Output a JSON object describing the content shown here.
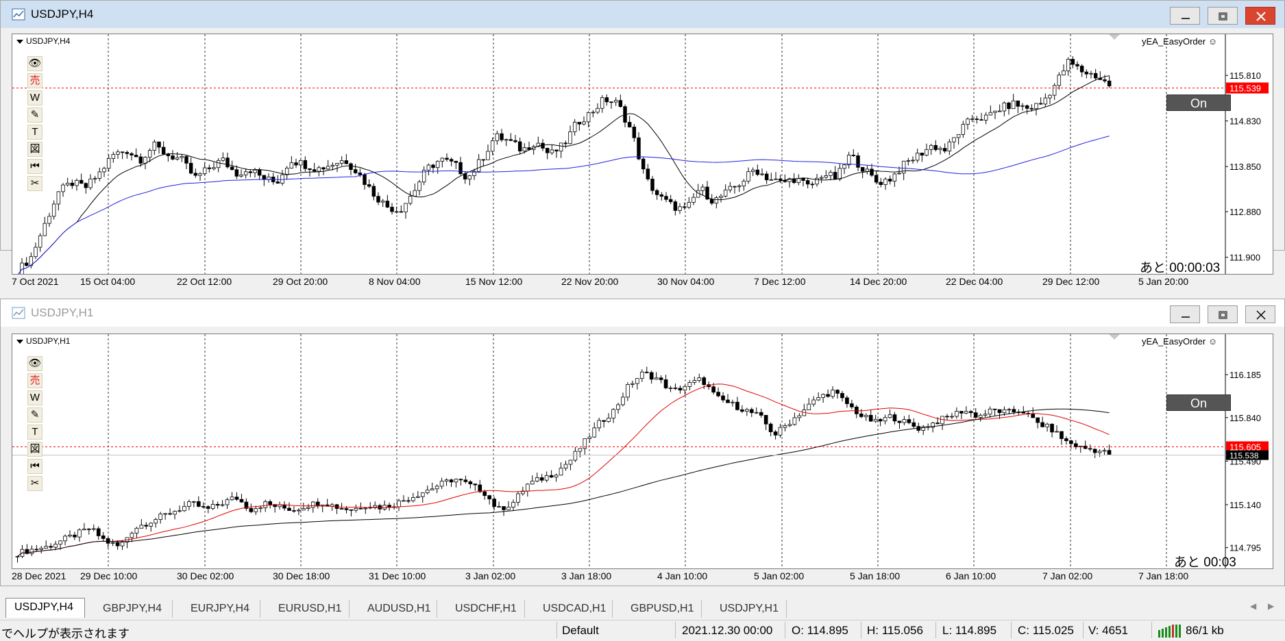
{
  "window1": {
    "title": "USDJPY,H4",
    "symbol_label": "USDJPY,H4",
    "ea_label": "yEA_EasyOrder ☺",
    "on_label": "On",
    "remaining": "あと 00:00:03",
    "current_price": "115.539",
    "price_axis": [
      "115.810",
      "114.830",
      "113.850",
      "112.880",
      "111.900"
    ],
    "x_labels": [
      "7 Oct 2021",
      "15 Oct 04:00",
      "22 Oct 12:00",
      "29 Oct 20:00",
      "8 Nov 04:00",
      "15 Nov 12:00",
      "22 Nov 20:00",
      "30 Nov 04:00",
      "7 Dec 12:00",
      "14 Dec 20:00",
      "22 Dec 04:00",
      "29 Dec 12:00",
      "5 Jan 20:00"
    ]
  },
  "window2": {
    "title": "USDJPY,H1",
    "symbol_label": "USDJPY,H1",
    "ea_label": "yEA_EasyOrder ☺",
    "on_label": "On",
    "remaining": "あと 00:03",
    "current_price": "115.605",
    "bid_price": "115.538",
    "price_axis": [
      "116.185",
      "115.840",
      "115.490",
      "115.140",
      "114.795"
    ],
    "x_labels": [
      "28 Dec 2021",
      "29 Dec 10:00",
      "30 Dec 02:00",
      "30 Dec 18:00",
      "31 Dec 10:00",
      "3 Jan 02:00",
      "3 Jan 18:00",
      "4 Jan 10:00",
      "5 Jan 02:00",
      "5 Jan 18:00",
      "6 Jan 10:00",
      "7 Jan 02:00",
      "7 Jan 18:00"
    ]
  },
  "tools": [
    {
      "name": "eye-icon",
      "glyph": "👁"
    },
    {
      "name": "sell-icon",
      "glyph": "売"
    },
    {
      "name": "w-icon",
      "glyph": "W"
    },
    {
      "name": "pencil-icon",
      "glyph": "✎"
    },
    {
      "name": "text-icon",
      "glyph": "T"
    },
    {
      "name": "figure-icon",
      "glyph": "図"
    },
    {
      "name": "rewind-icon",
      "glyph": "⏮"
    },
    {
      "name": "scissors-icon",
      "glyph": "✂"
    }
  ],
  "tabs": [
    "USDJPY,H4",
    "GBPJPY,H4",
    "EURJPY,H4",
    "EURUSD,H1",
    "AUDUSD,H1",
    "USDCHF,H1",
    "USDCAD,H1",
    "GBPUSD,H1",
    "USDJPY,H1"
  ],
  "status": {
    "help": "でヘルプが表示されます",
    "profile": "Default",
    "datetime": "2021.12.30 00:00",
    "open": "O: 114.895",
    "high": "H: 115.056",
    "low": "L: 114.895",
    "close": "C: 115.025",
    "volume": "V: 4651",
    "traffic": "86/1 kb"
  },
  "colors": {
    "ma_blue": "#2020e0",
    "ma_red": "#e00000",
    "price_red": "#ff0000",
    "bid_black": "#000000",
    "active_title": "#cfe0f2"
  },
  "chart_data": [
    {
      "type": "candlestick",
      "symbol": "USDJPY",
      "timeframe": "H4",
      "ylim": [
        111.6,
        116.4
      ],
      "x_ticks": [
        "7 Oct 2021",
        "15 Oct 04:00",
        "22 Oct 12:00",
        "29 Oct 20:00",
        "8 Nov 04:00",
        "15 Nov 12:00",
        "22 Nov 20:00",
        "30 Nov 04:00",
        "7 Dec 12:00",
        "14 Dec 20:00",
        "22 Dec 04:00",
        "29 Dec 12:00",
        "5 Jan 20:00"
      ],
      "y_ticks": [
        115.81,
        114.83,
        113.85,
        112.88,
        111.9
      ],
      "current_price": 115.539,
      "close_path": [
        111.6,
        111.9,
        112.6,
        113.3,
        113.5,
        113.4,
        113.7,
        114.1,
        114.2,
        114.0,
        114.3,
        114.1,
        114.0,
        113.6,
        113.8,
        114.0,
        113.7,
        113.8,
        113.6,
        113.5,
        114.0,
        113.9,
        113.8,
        113.9,
        114.0,
        113.7,
        113.3,
        113.0,
        112.9,
        113.3,
        113.8,
        114.0,
        113.9,
        113.6,
        114.0,
        114.5,
        114.4,
        114.2,
        114.4,
        114.1,
        114.3,
        114.8,
        115.0,
        115.3,
        115.2,
        114.6,
        113.6,
        113.2,
        113.0,
        112.9,
        113.4,
        113.1,
        113.3,
        113.5,
        113.8,
        113.6,
        113.5,
        113.6,
        113.4,
        113.7,
        113.6,
        114.1,
        113.8,
        113.5,
        113.6,
        113.9,
        114.1,
        114.3,
        114.2,
        114.6,
        114.9,
        114.9,
        115.1,
        115.2,
        115.1,
        115.2,
        115.6,
        116.1,
        115.9,
        115.8,
        115.6
      ]
    },
    {
      "type": "candlestick",
      "symbol": "USDJPY",
      "timeframe": "H1",
      "ylim": [
        114.65,
        116.4
      ],
      "x_ticks": [
        "28 Dec 2021",
        "29 Dec 10:00",
        "30 Dec 02:00",
        "30 Dec 18:00",
        "31 Dec 10:00",
        "3 Jan 02:00",
        "3 Jan 18:00",
        "4 Jan 10:00",
        "5 Jan 02:00",
        "5 Jan 18:00",
        "6 Jan 10:00",
        "7 Jan 02:00",
        "7 Jan 18:00"
      ],
      "y_ticks": [
        116.185,
        115.84,
        115.49,
        115.14,
        114.795
      ],
      "current_price": 115.605,
      "bid_price": 115.538,
      "close_path": [
        114.75,
        114.78,
        114.8,
        114.85,
        114.9,
        114.95,
        114.85,
        114.8,
        114.95,
        115.0,
        115.05,
        115.1,
        115.15,
        115.1,
        115.15,
        115.2,
        115.1,
        115.15,
        115.12,
        115.1,
        115.14,
        115.16,
        115.12,
        115.1,
        115.14,
        115.12,
        115.15,
        115.2,
        115.25,
        115.3,
        115.35,
        115.3,
        115.25,
        115.1,
        115.15,
        115.3,
        115.35,
        115.4,
        115.5,
        115.65,
        115.8,
        115.9,
        116.1,
        116.2,
        116.15,
        116.05,
        116.1,
        116.15,
        116.0,
        115.95,
        115.9,
        115.85,
        115.7,
        115.8,
        115.9,
        116.0,
        116.05,
        115.95,
        115.85,
        115.8,
        115.85,
        115.8,
        115.75,
        115.8,
        115.85,
        115.9,
        115.85,
        115.9,
        115.88,
        115.9,
        115.8,
        115.75,
        115.65,
        115.6,
        115.58,
        115.55
      ]
    }
  ]
}
